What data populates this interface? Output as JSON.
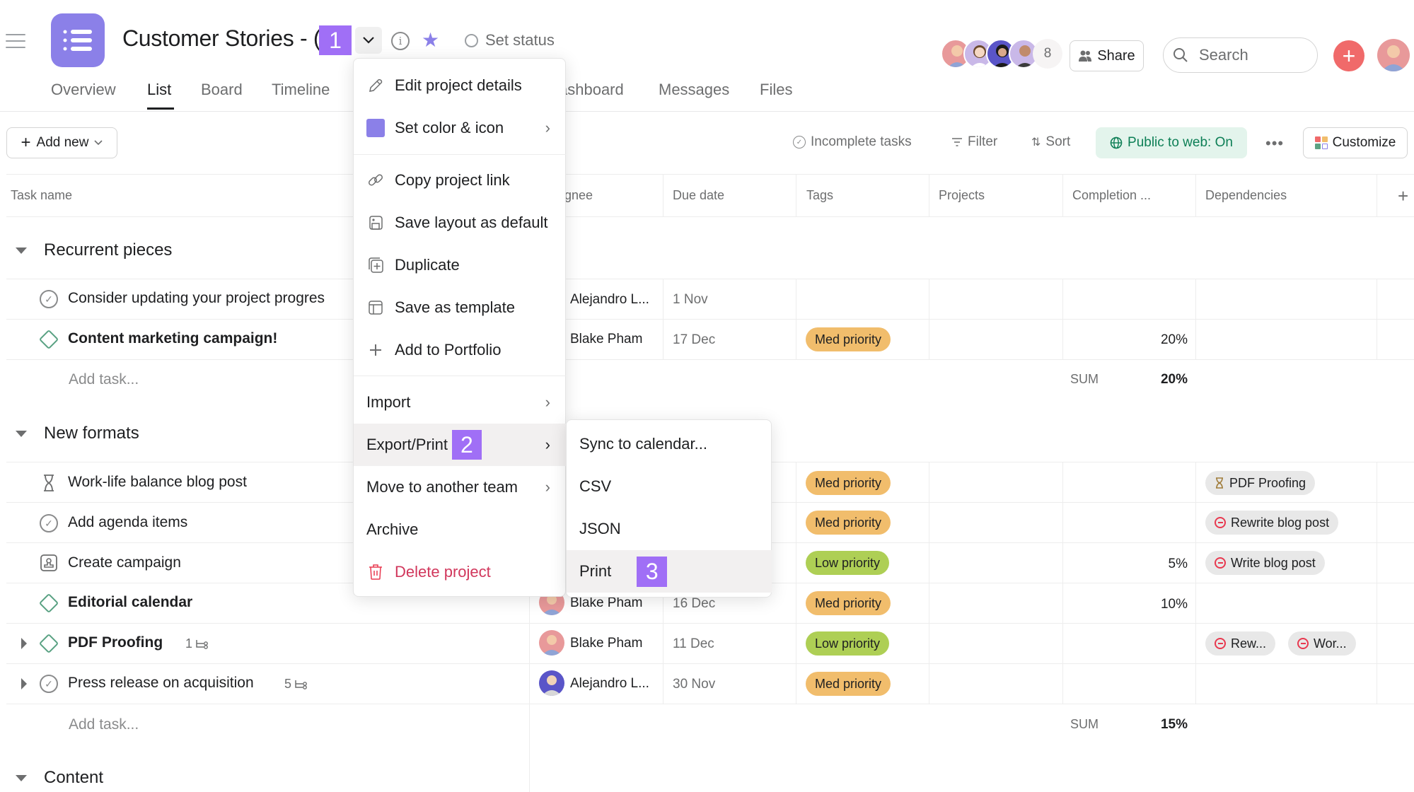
{
  "header": {
    "project_title": "Customer Stories - (",
    "set_status_label": "Set status",
    "accent_color": "#8b80e8",
    "tabs": [
      {
        "label": "Overview",
        "active": false
      },
      {
        "label": "List",
        "active": true
      },
      {
        "label": "Board",
        "active": false
      },
      {
        "label": "Timeline",
        "active": false
      },
      {
        "label": "ashboard",
        "active": false
      },
      {
        "label": "Messages",
        "active": false
      },
      {
        "label": "Files",
        "active": false
      }
    ],
    "members_extra_count": "8",
    "share_label": "Share",
    "search_placeholder": "Search"
  },
  "step_badges": {
    "one": "1",
    "two": "2",
    "three": "3"
  },
  "toolbar": {
    "add_new_label": "Add new",
    "incomplete_label": "Incomplete tasks",
    "filter_label": "Filter",
    "sort_label": "Sort",
    "public_label": "Public to web: On",
    "customize_label": "Customize"
  },
  "columns": {
    "task_name": "Task name",
    "assignee": "gnee",
    "due_date": "Due date",
    "tags": "Tags",
    "projects": "Projects",
    "completion": "Completion ...",
    "dependencies": "Dependencies"
  },
  "sections": [
    {
      "name": "Recurrent pieces",
      "tasks": [
        {
          "name": "Consider updating your project progres",
          "bold": false,
          "icon": "check-circle",
          "assignee": "Alejandro L...",
          "due": "1 Nov",
          "tag": "",
          "tag_type": "",
          "completion": "",
          "deps": []
        },
        {
          "name": "Content marketing campaign!",
          "bold": true,
          "icon": "milestone",
          "assignee": "Blake Pham",
          "due": "17 Dec",
          "tag": "Med priority",
          "tag_type": "med",
          "completion": "20%",
          "deps": []
        }
      ],
      "add_task": "Add task...",
      "sum_label": "SUM",
      "sum_value": "20%"
    },
    {
      "name": "New formats",
      "tasks": [
        {
          "name": "Work-life balance blog post",
          "bold": false,
          "icon": "hourglass",
          "tag": "Med priority",
          "tag_type": "med",
          "completion": "",
          "deps": [
            {
              "label": "PDF Proofing",
              "icon": "hourglass"
            }
          ]
        },
        {
          "name": "Add agenda items",
          "bold": false,
          "icon": "check-circle",
          "tag": "Med priority",
          "tag_type": "med",
          "completion": "",
          "deps": [
            {
              "label": "Rewrite blog post",
              "icon": "blocked"
            }
          ]
        },
        {
          "name": "Create campaign",
          "bold": false,
          "icon": "approval",
          "tag": "Low priority",
          "tag_type": "low",
          "completion": "5%",
          "deps": [
            {
              "label": "Write blog post",
              "icon": "blocked"
            }
          ]
        },
        {
          "name": "Editorial calendar",
          "bold": true,
          "icon": "milestone",
          "assignee": "Blake Pham",
          "due": "16 Dec",
          "tag": "Med priority",
          "tag_type": "med",
          "completion": "10%",
          "deps": []
        },
        {
          "name": "PDF Proofing",
          "bold": true,
          "icon": "milestone",
          "subtasks": "1",
          "assignee": "Blake Pham",
          "due": "11 Dec",
          "tag": "Low priority",
          "tag_type": "low",
          "completion": "",
          "deps": [
            {
              "label": "Rew...",
              "icon": "blocked"
            },
            {
              "label": "Wor...",
              "icon": "blocked"
            }
          ]
        },
        {
          "name": "Press release on acquisition",
          "bold": false,
          "icon": "check-circle",
          "subtasks": "5",
          "assignee": "Alejandro L...",
          "due": "30 Nov",
          "tag": "Med priority",
          "tag_type": "med",
          "completion": "",
          "deps": []
        }
      ],
      "add_task": "Add task...",
      "sum_label": "SUM",
      "sum_value": "15%"
    },
    {
      "name": "Content"
    }
  ],
  "project_menu": {
    "items": [
      {
        "label": "Edit project details",
        "icon": "pencil"
      },
      {
        "label": "Set color & icon",
        "icon": "color-swatch",
        "has_submenu": true
      },
      {
        "label": "Copy project link",
        "icon": "link"
      },
      {
        "label": "Save layout as default",
        "icon": "save-layout"
      },
      {
        "label": "Duplicate",
        "icon": "duplicate"
      },
      {
        "label": "Save as template",
        "icon": "template"
      },
      {
        "label": "Add to Portfolio",
        "icon": "plus"
      },
      {
        "label": "Import",
        "has_submenu": true
      },
      {
        "label": "Export/Print",
        "has_submenu": true,
        "highlighted": true
      },
      {
        "label": "Move to another team",
        "has_submenu": true
      },
      {
        "label": "Archive"
      },
      {
        "label": "Delete project",
        "icon": "trash",
        "danger": true
      }
    ]
  },
  "export_submenu": {
    "items": [
      {
        "label": "Sync to calendar..."
      },
      {
        "label": "CSV"
      },
      {
        "label": "JSON"
      },
      {
        "label": "Print",
        "highlighted": true
      }
    ]
  }
}
